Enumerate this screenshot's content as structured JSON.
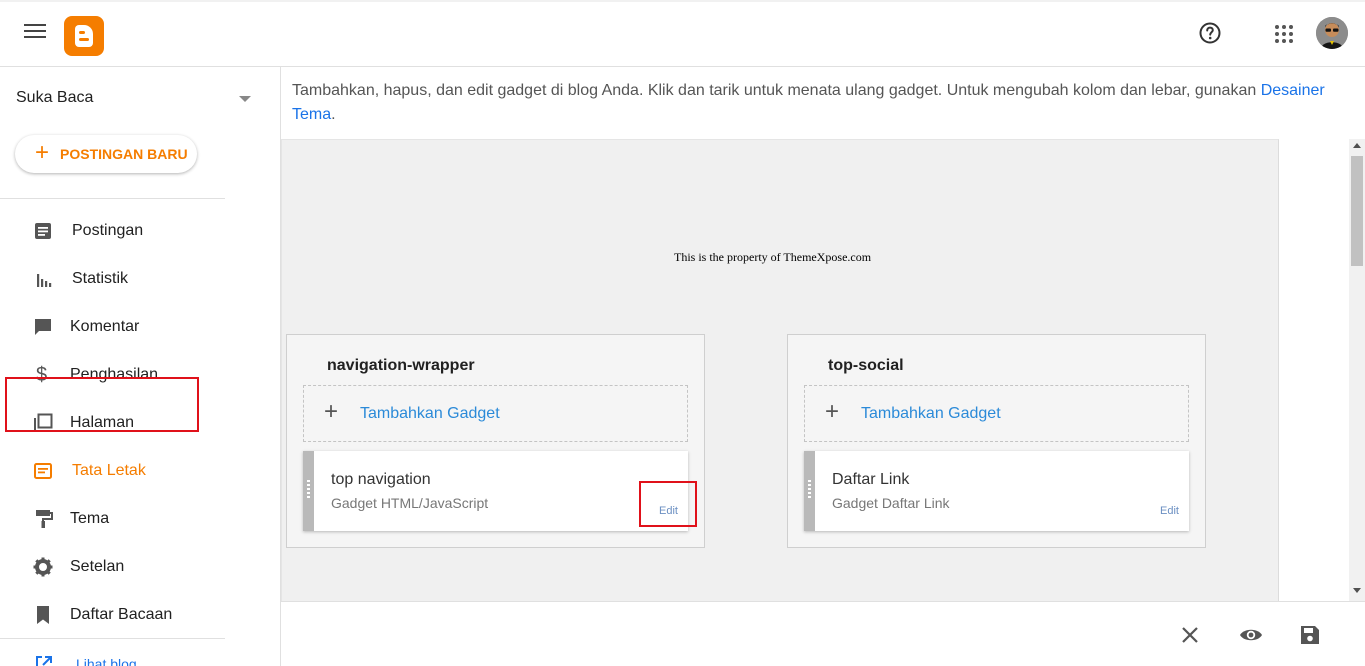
{
  "sidebar": {
    "blog_name": "Suka Baca",
    "new_post_label": "POSTINGAN BARU",
    "items": [
      {
        "label": "Postingan",
        "icon": "posts-icon"
      },
      {
        "label": "Statistik",
        "icon": "stats-icon"
      },
      {
        "label": "Komentar",
        "icon": "comment-icon"
      },
      {
        "label": "Penghasilan",
        "icon": "dollar-icon"
      },
      {
        "label": "Halaman",
        "icon": "pages-icon"
      },
      {
        "label": "Tata Letak",
        "icon": "layout-icon",
        "active": true
      },
      {
        "label": "Tema",
        "icon": "paint-roller-icon"
      },
      {
        "label": "Setelan",
        "icon": "gear-icon"
      },
      {
        "label": "Daftar Bacaan",
        "icon": "bookmark-icon"
      }
    ],
    "view_blog_label": "Lihat blog"
  },
  "main": {
    "intro_text": "Tambahkan, hapus, dan edit gadget di blog Anda. Klik dan tarik untuk menata ulang gadget. Untuk mengubah kolom dan lebar, gunakan ",
    "intro_link": "Desainer Tema",
    "intro_end": ".",
    "property_text": "This is the property of ThemeXpose.com",
    "sections": [
      {
        "title": "navigation-wrapper",
        "add_gadget_label": "Tambahkan Gadget",
        "gadget": {
          "title": "top navigation",
          "subtitle": "Gadget HTML/JavaScript",
          "edit_label": "Edit"
        }
      },
      {
        "title": "top-social",
        "add_gadget_label": "Tambahkan Gadget",
        "gadget": {
          "title": "Daftar Link",
          "subtitle": "Gadget Daftar Link",
          "edit_label": "Edit"
        }
      }
    ]
  },
  "colors": {
    "accent": "#f57d00",
    "link": "#1a73e8",
    "highlight": "#e0111a"
  }
}
